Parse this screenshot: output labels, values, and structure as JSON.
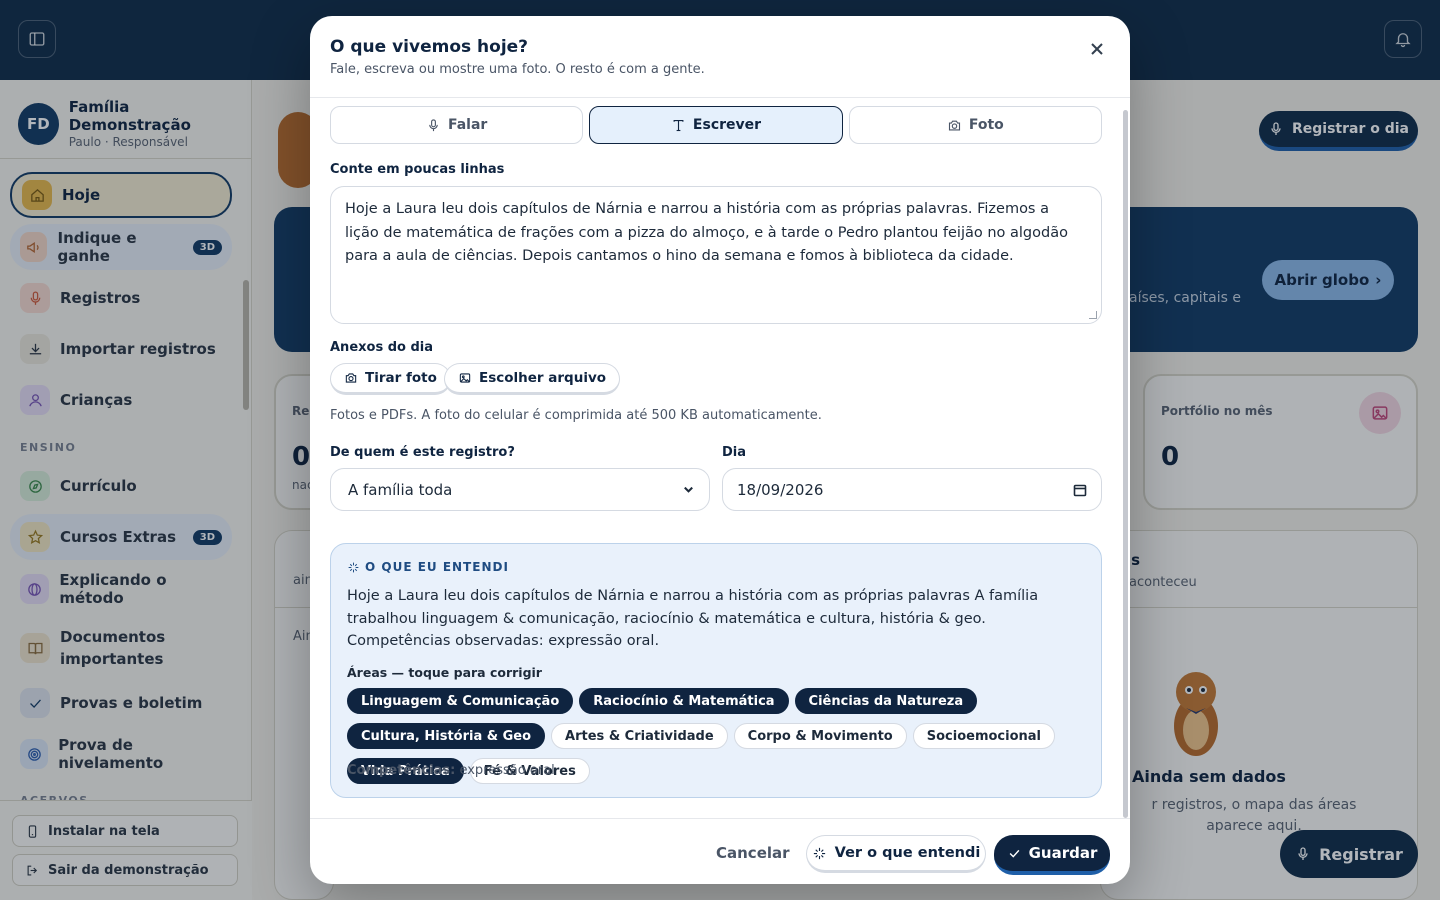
{
  "sidebar": {
    "family_initials": "FD",
    "family_name": "Família Demonstração",
    "family_role": "Paulo · Responsável",
    "items": [
      {
        "label": "Hoje"
      },
      {
        "label": "Indique e ganhe",
        "badge": "3D"
      },
      {
        "label": "Registros"
      },
      {
        "label": "Importar registros"
      },
      {
        "label": "Crianças"
      },
      {
        "label": "Currículo"
      },
      {
        "label": "Cursos Extras",
        "badge": "3D"
      },
      {
        "label": "Explicando o método"
      },
      {
        "label": "Documentos importantes"
      },
      {
        "label": "Provas e boletim"
      },
      {
        "label": "Prova de nivelamento"
      }
    ],
    "section_ensino": "ENSINO",
    "section_acervos": "ACERVOS",
    "install_label": "Instalar na tela",
    "exit_label": "Sair da demonstração"
  },
  "main": {
    "register_day_label": "Registrar o dia",
    "globe_text": "aíses, capitais e",
    "globe_button": "Abrir globo",
    "stat_left_label": "Reg",
    "stat_left_value": "0",
    "stat_left_sub": "nac",
    "portfolio_label": "Portfólio no mês",
    "portfolio_value": "0",
    "panel_left_sub": "ain",
    "panel_left_line": "Ain",
    "panel_right_title": "as",
    "panel_right_sub": "aconteceu",
    "empty_title": "Ainda sem dados",
    "empty_text": "r registros, o mapa das áreas aparece aqui.",
    "float_register": "Registrar"
  },
  "modal": {
    "title": "O que vivemos hoje?",
    "subtitle": "Fale, escreva ou mostre uma foto. O resto é com a gente.",
    "tabs": [
      {
        "label": "Falar",
        "icon": "mic-icon"
      },
      {
        "label": "Escrever",
        "icon": "text-icon",
        "active": true
      },
      {
        "label": "Foto",
        "icon": "camera-icon"
      }
    ],
    "text_label": "Conte em poucas linhas",
    "text_value": "Hoje a Laura leu dois capítulos de Nárnia e narrou a história com as próprias palavras. Fizemos a lição de matemática de frações com a pizza do almoço, e à tarde o Pedro plantou feijão no algodão para a aula de ciências. Depois cantamos o hino da semana e fomos à biblioteca da cidade.",
    "attachments_label": "Anexos do dia",
    "take_photo": "Tirar foto",
    "choose_file": "Escolher arquivo",
    "attachments_hint": "Fotos e PDFs. A foto do celular é comprimida até 500 KB automaticamente.",
    "whose_label": "De quem é este registro?",
    "whose_value": "A família toda",
    "day_label": "Dia",
    "day_value": "18/09/2026",
    "insight": {
      "title": "O QUE EU ENTENDI",
      "text": "Hoje a Laura leu dois capítulos de Nárnia e narrou a história com as próprias palavras A família trabalhou linguagem & comunicação, raciocínio & matemática e cultura, história & geo. Competências observadas: expressão oral.",
      "areas_label": "Áreas — toque para corrigir",
      "areas": [
        {
          "label": "Linguagem & Comunicação",
          "selected": true
        },
        {
          "label": "Raciocínio & Matemática",
          "selected": true
        },
        {
          "label": "Ciências da Natureza",
          "selected": true
        },
        {
          "label": "Cultura, História & Geo",
          "selected": true
        },
        {
          "label": "Artes & Criatividade",
          "selected": false
        },
        {
          "label": "Corpo & Movimento",
          "selected": false
        },
        {
          "label": "Socioemocional",
          "selected": false
        },
        {
          "label": "Vida Prática",
          "selected": true
        },
        {
          "label": "Fé & Valores",
          "selected": false
        }
      ],
      "competencies_label": "Competências:",
      "competencies_value": "expressão oral"
    },
    "cancel": "Cancelar",
    "see_understood": "Ver o que entendi",
    "save": "Guardar"
  },
  "colors": {
    "navy": "#0f2440",
    "topbar": "#102c48",
    "accent_blue": "#1f5fa8",
    "insight_bg": "#e9f1fb"
  }
}
